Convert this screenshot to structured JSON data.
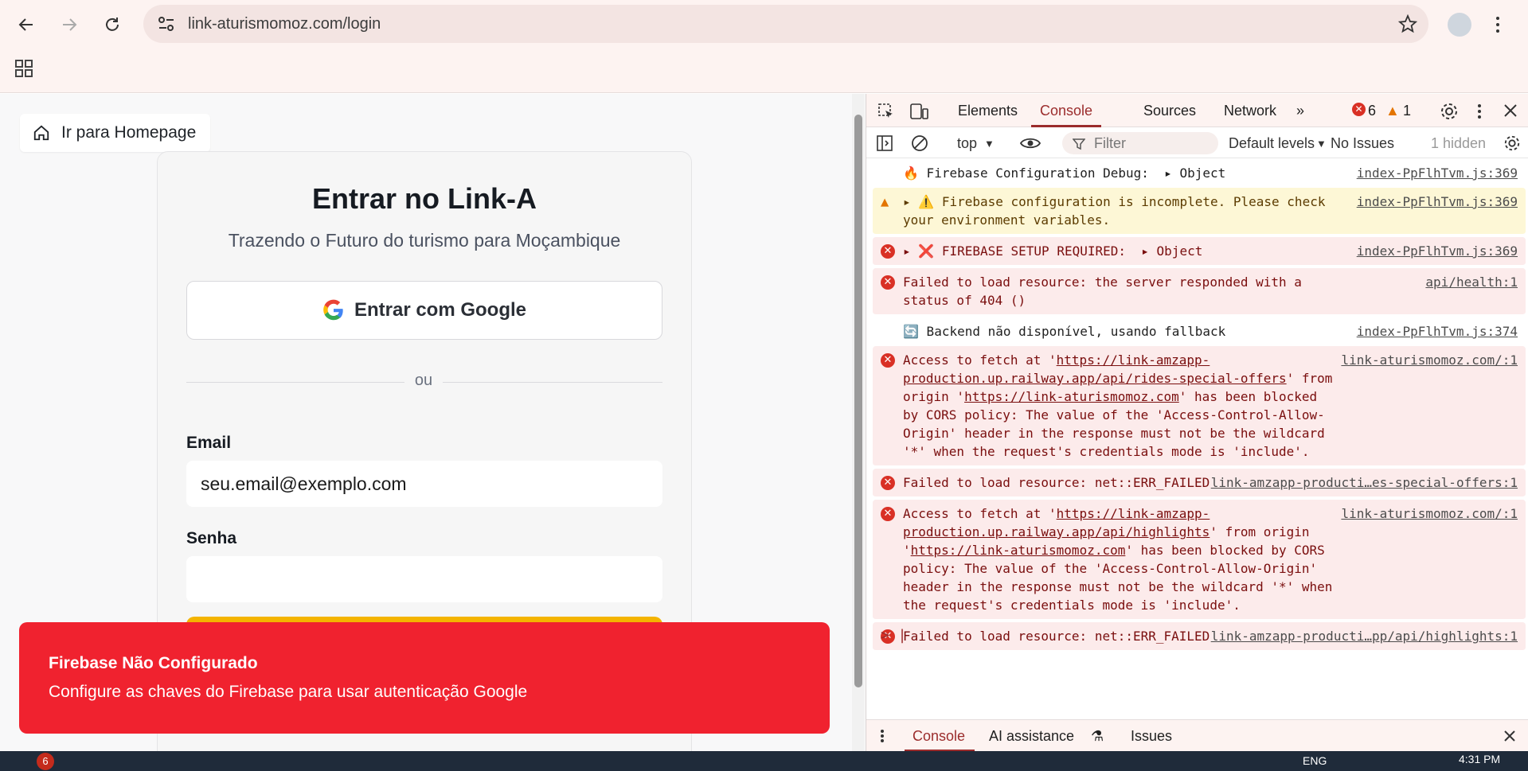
{
  "browser": {
    "url": "link-aturismomoz.com/login"
  },
  "page": {
    "home_button_label": "Ir para Homepage",
    "card_title": "Entrar no Link-A",
    "card_subtitle": "Trazendo o Futuro do turismo para Moçambique",
    "google_button_label": "Entrar com Google",
    "divider_text": "ou",
    "email_label": "Email",
    "email_value": "seu.email@exemplo.com",
    "password_label": "Senha",
    "password_value": ""
  },
  "toast": {
    "title": "Firebase Não Configurado",
    "message": "Configure as chaves do Firebase para usar autenticação Google"
  },
  "devtools": {
    "tabs": [
      "Elements",
      "Console",
      "Sources",
      "Network"
    ],
    "active_tab": "Console",
    "error_count": "6",
    "warning_count": "1",
    "context": "top",
    "filter_placeholder": "Filter",
    "levels": "Default levels",
    "issues": "No Issues",
    "hidden": "1 hidden",
    "drawer_tabs": [
      "Console",
      "AI assistance",
      "Issues"
    ],
    "messages": [
      {
        "kind": "info",
        "text": "🔥 Firebase Configuration Debug:  ▸ Object",
        "source": "index-PpFlhTvm.js:369"
      },
      {
        "kind": "warn",
        "text": "▸ ⚠️ Firebase configuration is incomplete. Please check your environment variables.",
        "source": "index-PpFlhTvm.js:369"
      },
      {
        "kind": "err",
        "text": "▸ ❌ FIREBASE SETUP REQUIRED:  ▸ Object",
        "source": "index-PpFlhTvm.js:369"
      },
      {
        "kind": "err",
        "text": "Failed to load resource: the server responded with a status of 404 ()",
        "source": "api/health:1"
      },
      {
        "kind": "info",
        "text": "🔄 Backend não disponível, usando fallback",
        "source": "index-PpFlhTvm.js:374"
      },
      {
        "kind": "err",
        "text_pre": "Access to fetch at '",
        "link1": "https://link-amzapp-production.up.railway.app/api/rides-special-offers",
        "text_mid": "' from origin '",
        "link2": "https://link-aturismomoz.com",
        "text_post": "' has been blocked by CORS policy: The value of the 'Access-Control-Allow-Origin' header in the response must not be the wildcard '*' when the request's credentials mode is 'include'.",
        "source": "link-aturismomoz.com/:1"
      },
      {
        "kind": "err",
        "text": "Failed to load resource: net::ERR_FAILED",
        "source": "link-amzapp-producti…es-special-offers:1"
      },
      {
        "kind": "err",
        "text_pre": "Access to fetch at '",
        "link1": "https://link-amzapp-production.up.railway.app/api/highlights",
        "text_mid": "' from origin '",
        "link2": "https://link-aturismomoz.com",
        "text_post": "' has been blocked by CORS policy: The value of the 'Access-Control-Allow-Origin' header in the response must not be the wildcard '*' when the request's credentials mode is 'include'.",
        "source": "link-aturismomoz.com/:1"
      },
      {
        "kind": "err",
        "text": "Failed to load resource: net::ERR_FAILED",
        "source": "link-amzapp-producti…pp/api/highlights:1"
      }
    ]
  },
  "taskbar": {
    "notification_count": "6",
    "language": "ENG",
    "time": "4:31 PM"
  }
}
